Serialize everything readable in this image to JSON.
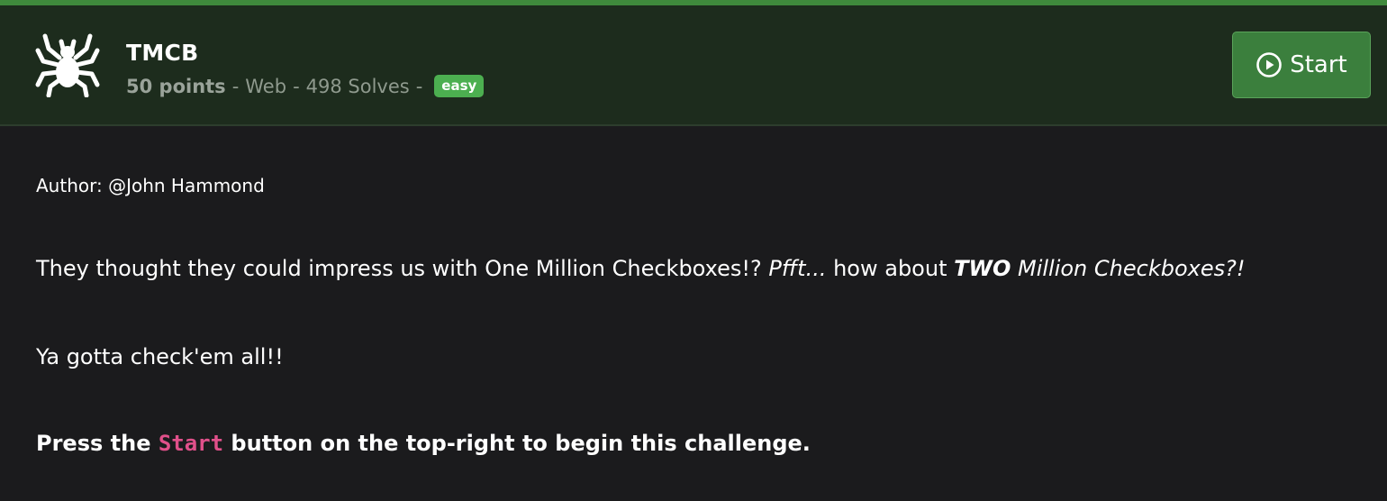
{
  "challenge": {
    "title": "TMCB",
    "points": "50 points",
    "category": "Web",
    "solves": "498 Solves",
    "separator": "-",
    "difficulty": "easy",
    "icon": "spider-icon"
  },
  "actions": {
    "start_label": "Start",
    "start_icon": "play-circle-icon"
  },
  "description": {
    "author": "Author: @John Hammond",
    "p1_a": "They thought they could impress us with One Million Checkboxes!? ",
    "p1_b": "Pfft...",
    "p1_c": " how about ",
    "p1_d": "TWO",
    "p1_e": " Million Checkboxes?!",
    "p2": "Ya gotta check'em all!!",
    "p3_a": "Press the ",
    "p3_code": "Start",
    "p3_b": " button on the top-right to begin this challenge."
  },
  "colors": {
    "accent": "#3f8a3c",
    "header_bg": "#1d2c1d",
    "badge": "#4caf50",
    "code": "#e0508a",
    "page_bg": "#1b1b1d"
  }
}
